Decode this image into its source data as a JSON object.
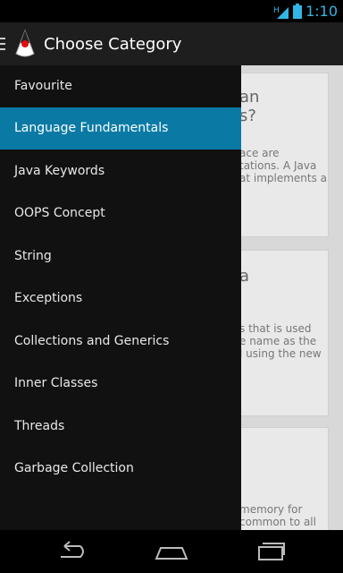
{
  "status": {
    "time": "1:10",
    "network": "H"
  },
  "actionbar": {
    "title": "Choose Category"
  },
  "drawer": {
    "items": [
      {
        "label": "Favourite"
      },
      {
        "label": "Language Fundamentals",
        "selected": true
      },
      {
        "label": "Java Keywords"
      },
      {
        "label": "OOPS Concept"
      },
      {
        "label": "String"
      },
      {
        "label": "Exceptions"
      },
      {
        "label": "Collections and Generics"
      },
      {
        "label": "Inner Classes"
      },
      {
        "label": "Threads"
      },
      {
        "label": "Garbage Collection"
      }
    ]
  },
  "background_cards": [
    {
      "question": "an\ns?",
      "answer": "ace are\ntations. A Java\nat implements a"
    },
    {
      "question": "a",
      "answer": "s that is used\ne name as the\nl using the new"
    },
    {
      "question": "",
      "answer": "memory for\ncommon to all"
    }
  ],
  "colors": {
    "accent": "#33b5e5",
    "selected": "#0a7aa5"
  }
}
